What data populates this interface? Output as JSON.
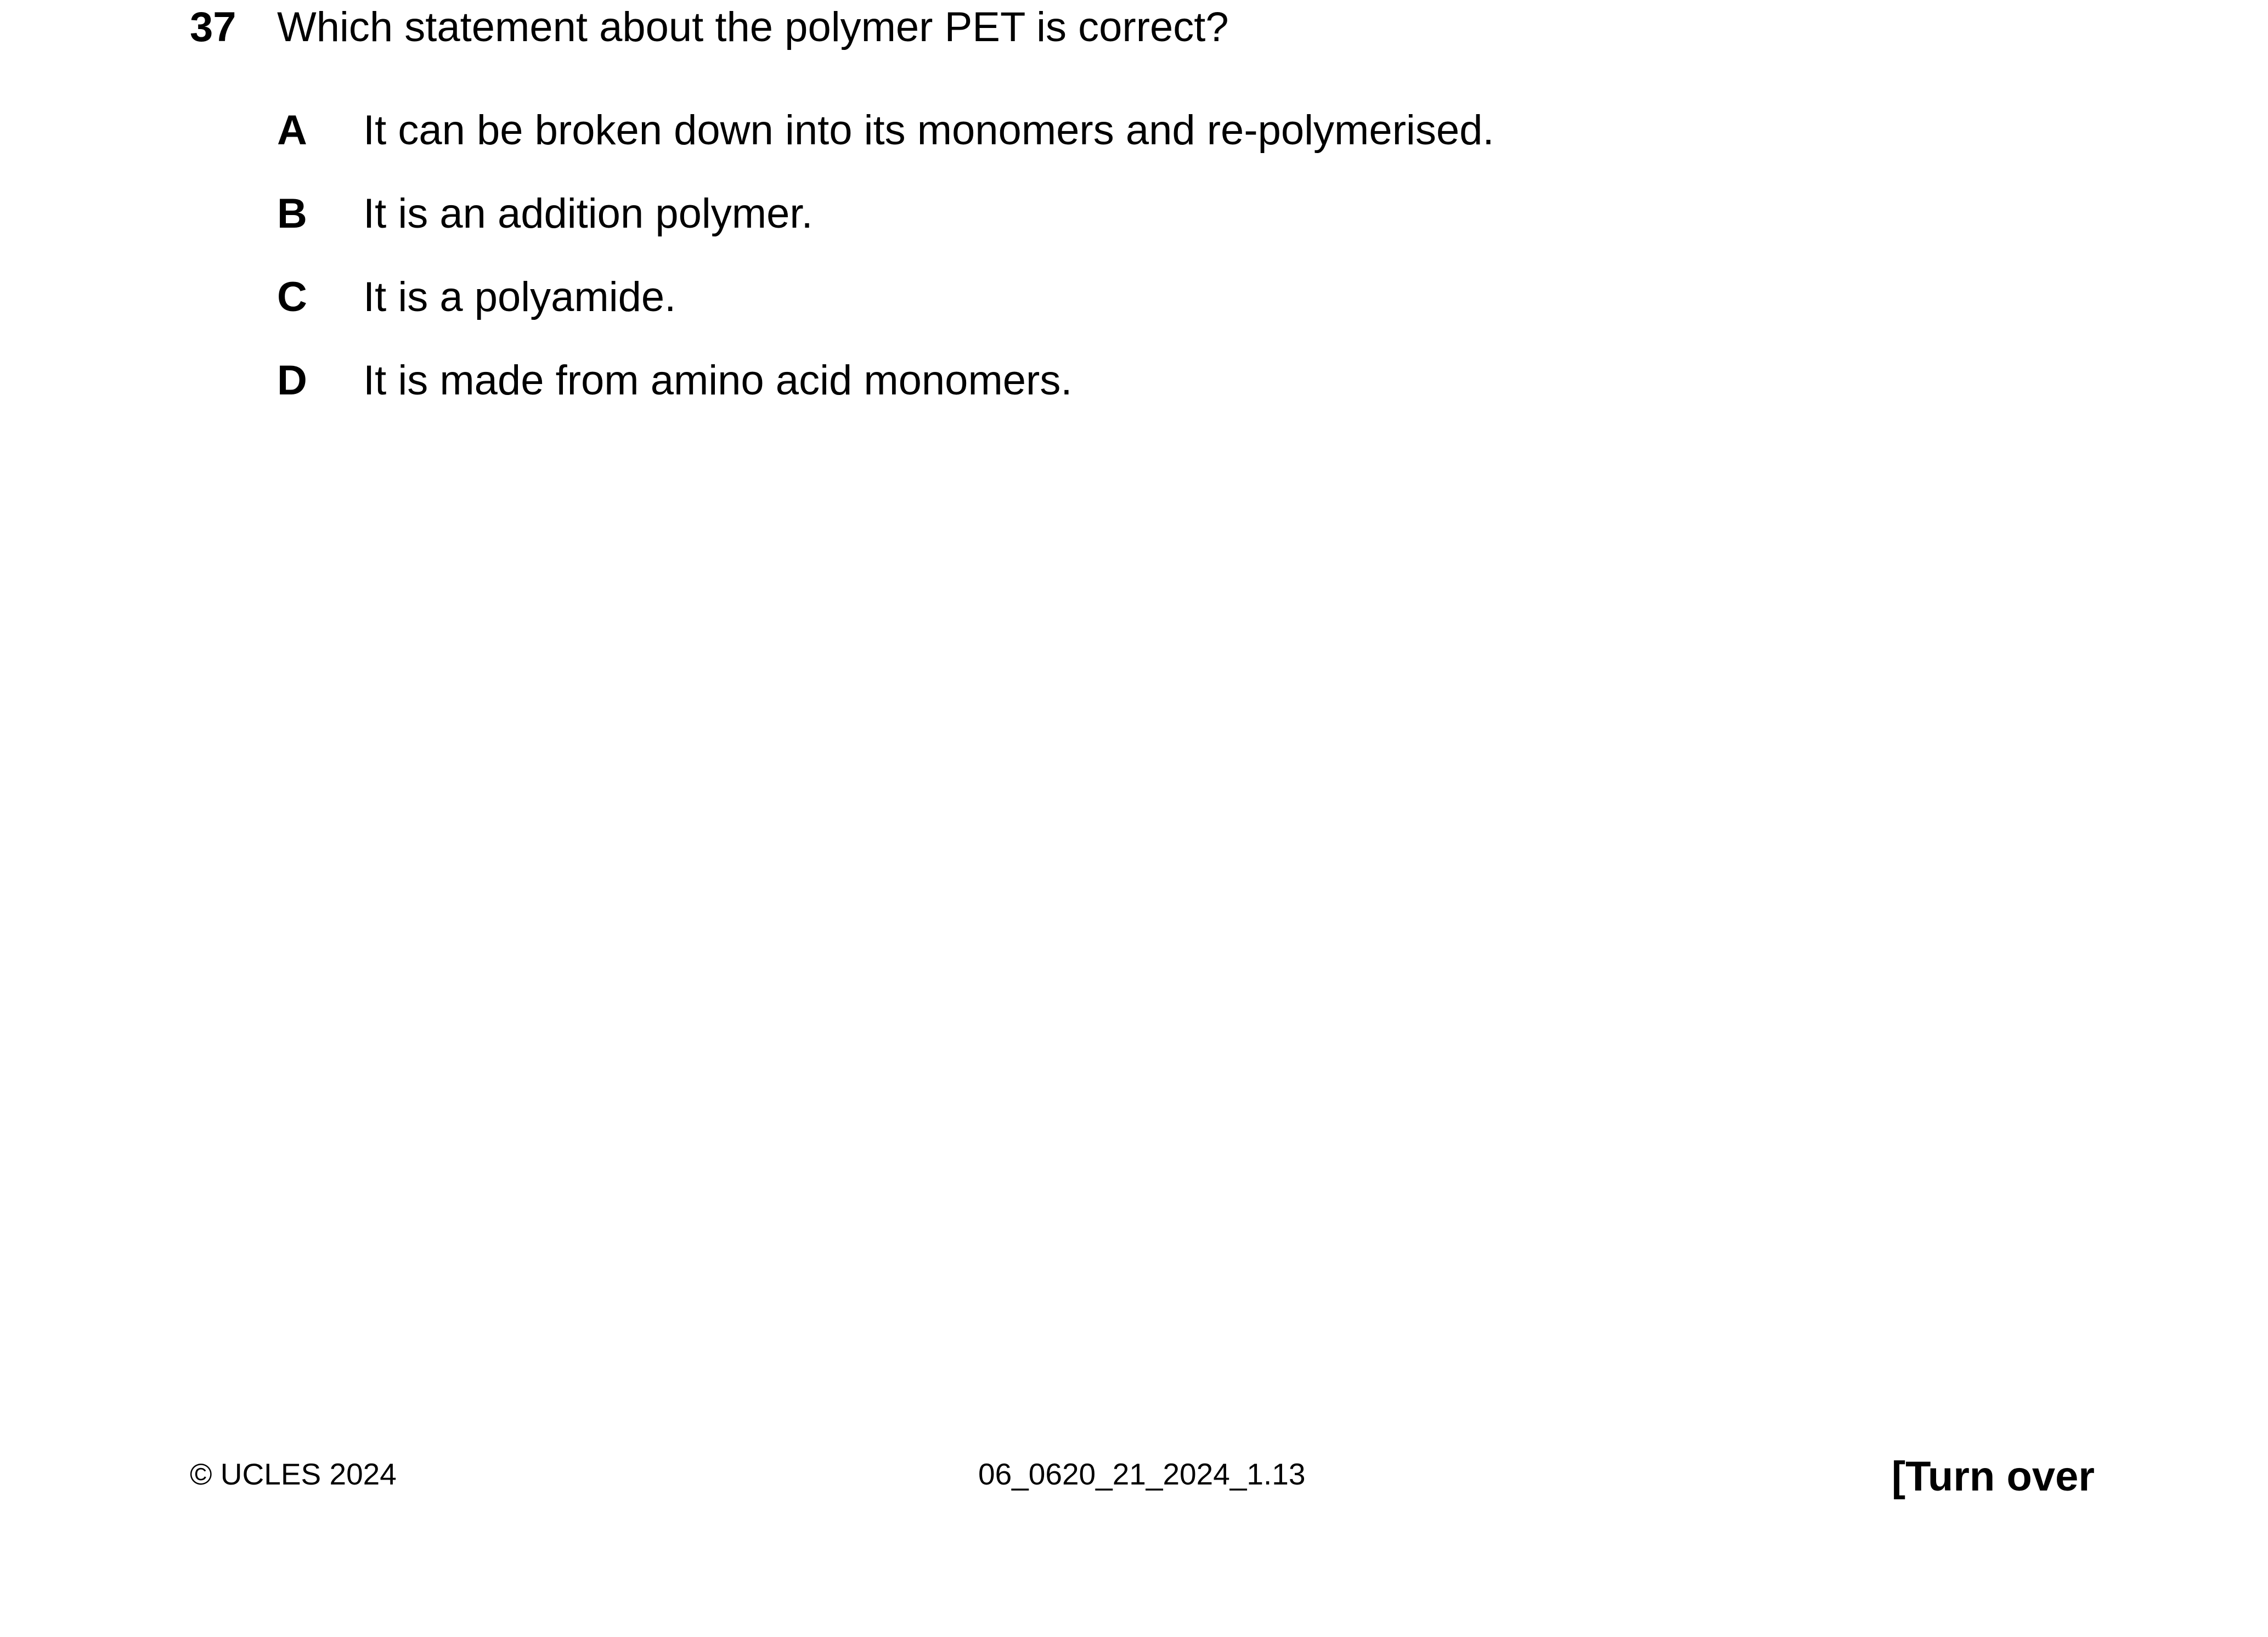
{
  "question": {
    "number": "37",
    "stem": "Which statement about the polymer PET is correct?",
    "options": [
      {
        "letter": "A",
        "text": "It can be broken down into its monomers and re-polymerised."
      },
      {
        "letter": "B",
        "text": "It is an addition polymer."
      },
      {
        "letter": "C",
        "text": "It is a polyamide."
      },
      {
        "letter": "D",
        "text": "It is made from amino acid monomers."
      }
    ]
  },
  "footer": {
    "copyright": "© UCLES 2024",
    "document_code": "06_0620_21_2024_1.13",
    "turn_over": "[Turn over"
  }
}
